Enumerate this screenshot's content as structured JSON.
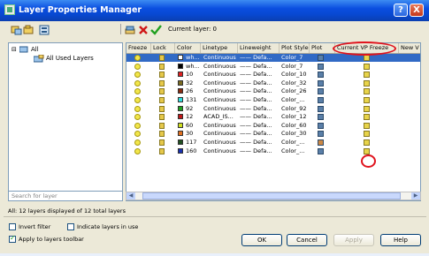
{
  "window": {
    "title": "Layer Properties Manager",
    "help": "?",
    "close": "X"
  },
  "toolbar": {
    "current_layer": "Current layer: 0"
  },
  "tree": {
    "all": "All",
    "all_used": "All Used Layers"
  },
  "search": {
    "placeholder": "Search for layer"
  },
  "columns": [
    "Freeze",
    "Lock",
    "Color",
    "Linetype",
    "Lineweight",
    "Plot Style",
    "Plot",
    "Current VP Freeze",
    "New V"
  ],
  "rows": [
    {
      "color_name": "wh...",
      "swatch": "#ffffff",
      "linetype": "Continuous",
      "lineweight": "—— Defa...",
      "plot_style": "Color_7",
      "selected": true
    },
    {
      "color_name": "wh...",
      "swatch": "#000000",
      "linetype": "Continuous",
      "lineweight": "—— Defa...",
      "plot_style": "Color_7"
    },
    {
      "color_name": "10",
      "swatch": "#e02020",
      "linetype": "Continuous",
      "lineweight": "—— Defa...",
      "plot_style": "Color_10"
    },
    {
      "color_name": "32",
      "swatch": "#7a6a20",
      "linetype": "Continuous",
      "lineweight": "—— Defa...",
      "plot_style": "Color_32"
    },
    {
      "color_name": "26",
      "swatch": "#8a2a10",
      "linetype": "Continuous",
      "lineweight": "—— Defa...",
      "plot_style": "Color_26"
    },
    {
      "color_name": "131",
      "swatch": "#30e0e0",
      "linetype": "Continuous",
      "lineweight": "—— Defa...",
      "plot_style": "Color_..."
    },
    {
      "color_name": "92",
      "swatch": "#20a020",
      "linetype": "Continuous",
      "lineweight": "—— Defa...",
      "plot_style": "Color_92"
    },
    {
      "color_name": "12",
      "swatch": "#c01818",
      "linetype": "ACAD_IS...",
      "lineweight": "—— Defa...",
      "plot_style": "Color_12"
    },
    {
      "color_name": "60",
      "swatch": "#d0e020",
      "linetype": "Continuous",
      "lineweight": "—— Defa...",
      "plot_style": "Color_60"
    },
    {
      "color_name": "30",
      "swatch": "#e07020",
      "linetype": "Continuous",
      "lineweight": "—— Defa...",
      "plot_style": "Color_30"
    },
    {
      "color_name": "117",
      "swatch": "#205020",
      "linetype": "Continuous",
      "lineweight": "—— Defa...",
      "plot_style": "Color_..."
    },
    {
      "color_name": "160",
      "swatch": "#1830b0",
      "linetype": "Continuous",
      "lineweight": "—— Defa...",
      "plot_style": "Color_..."
    }
  ],
  "status": "All: 12 layers displayed of 12 total layers",
  "options": {
    "invert_filter": "Invert filter",
    "indicate_layers": "Indicate layers in use",
    "apply_toolbar": "Apply to layers toolbar"
  },
  "buttons": {
    "ok": "OK",
    "cancel": "Cancel",
    "apply": "Apply",
    "help": "Help"
  }
}
